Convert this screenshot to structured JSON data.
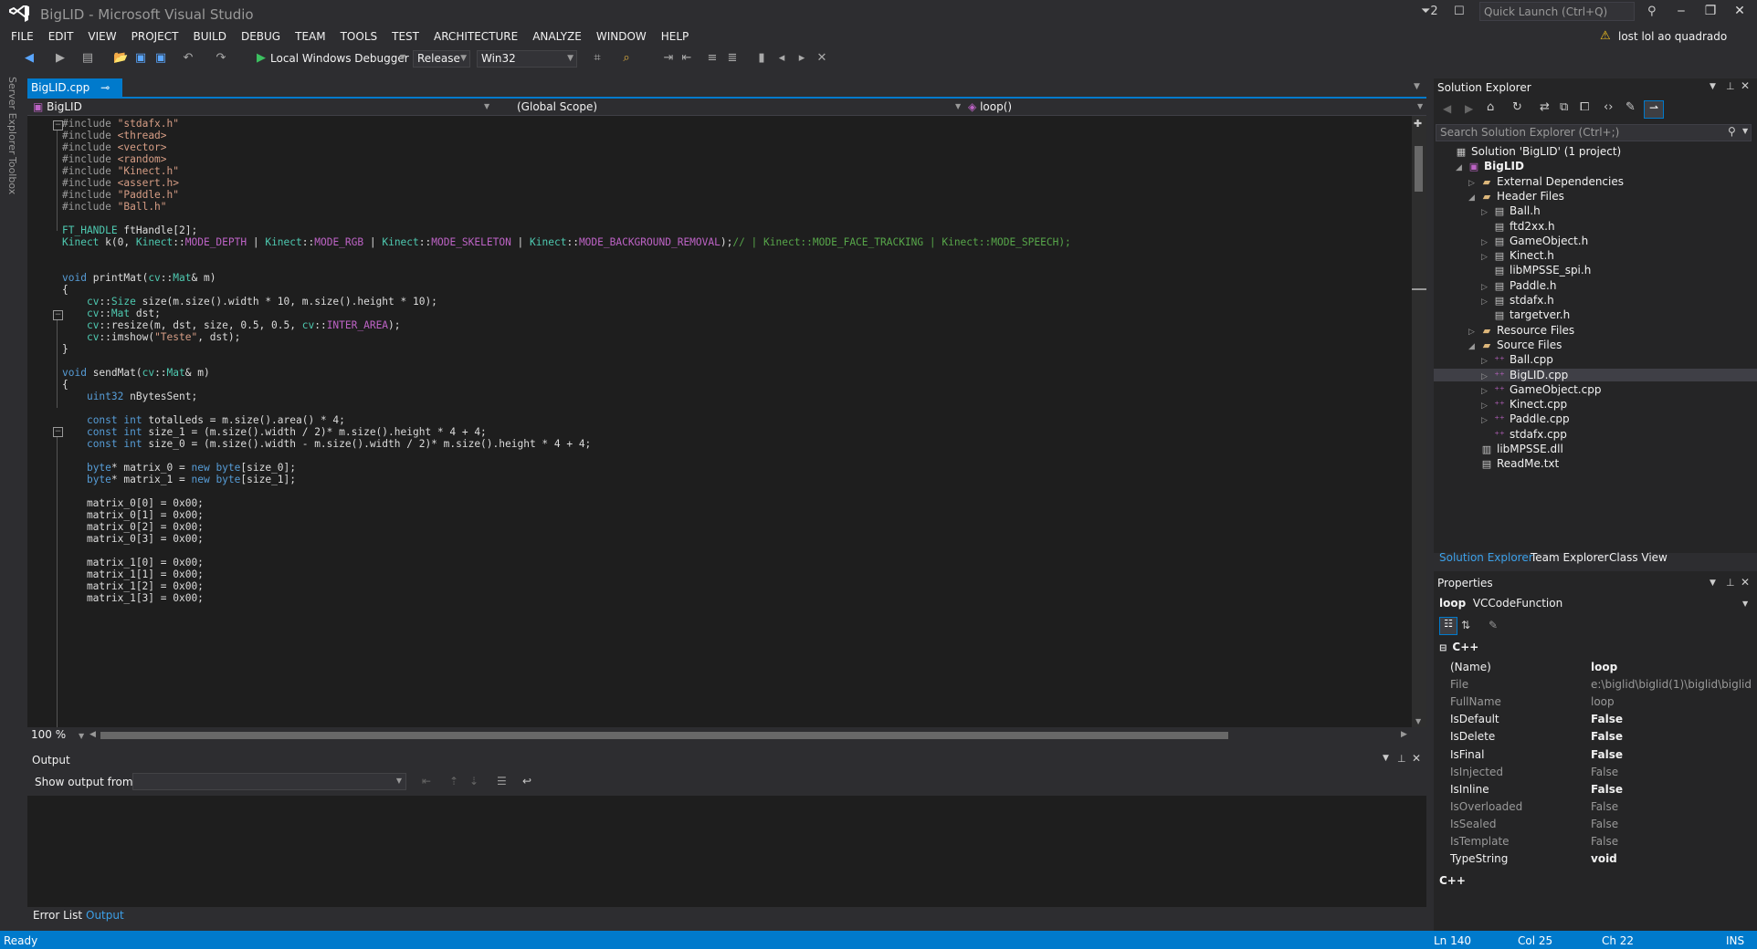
{
  "window": {
    "title": "BigLID - Microsoft Visual Studio",
    "notifications": "2",
    "quick_launch_placeholder": "Quick Launch (Ctrl+Q)",
    "user": "lost lol ao quadrado"
  },
  "menu": [
    "FILE",
    "EDIT",
    "VIEW",
    "PROJECT",
    "BUILD",
    "DEBUG",
    "TEAM",
    "TOOLS",
    "TEST",
    "ARCHITECTURE",
    "ANALYZE",
    "WINDOW",
    "HELP"
  ],
  "toolbar": {
    "debugger": "Local Windows Debugger",
    "config": "Release",
    "platform": "Win32"
  },
  "left_strip": [
    "Server Explorer",
    "Toolbox"
  ],
  "editor": {
    "tab": "BigLID.cpp",
    "nav_project": "BigLID",
    "nav_scope": "(Global Scope)",
    "nav_member": "loop()",
    "zoom": "100 %",
    "lines": [
      "#include \"stdafx.h\"",
      "#include <thread>",
      "#include <vector>",
      "#include <random>",
      "#include \"Kinect.h\"",
      "#include <assert.h>",
      "#include \"Paddle.h\"",
      "#include \"Ball.h\"",
      "",
      "FT_HANDLE ftHandle[2];",
      "Kinect k(0, Kinect::MODE_DEPTH | Kinect::MODE_RGB | Kinect::MODE_SKELETON | Kinect::MODE_BACKGROUND_REMOVAL);// | Kinect::MODE_FACE_TRACKING | Kinect::MODE_SPEECH);",
      "",
      "",
      "void printMat(cv::Mat& m)",
      "{",
      "    cv::Size size(m.size().width * 10, m.size().height * 10);",
      "    cv::Mat dst;",
      "    cv::resize(m, dst, size, 0.5, 0.5, cv::INTER_AREA);",
      "    cv::imshow(\"Teste\", dst);",
      "}",
      "",
      "void sendMat(cv::Mat& m)",
      "{",
      "    uint32 nBytesSent;",
      "",
      "    const int totalLeds = m.size().area() * 4;",
      "    const int size_1 = (m.size().width / 2)* m.size().height * 4 + 4;",
      "    const int size_0 = (m.size().width - m.size().width / 2)* m.size().height * 4 + 4;",
      "",
      "    byte* matrix_0 = new byte[size_0];",
      "    byte* matrix_1 = new byte[size_1];",
      "",
      "    matrix_0[0] = 0x00;",
      "    matrix_0[1] = 0x00;",
      "    matrix_0[2] = 0x00;",
      "    matrix_0[3] = 0x00;",
      "",
      "    matrix_1[0] = 0x00;",
      "    matrix_1[1] = 0x00;",
      "    matrix_1[2] = 0x00;",
      "    matrix_1[3] = 0x00;"
    ]
  },
  "output": {
    "title": "Output",
    "show_from": "Show output from:",
    "tabs": [
      "Error List",
      "Output"
    ]
  },
  "status": {
    "left": "Ready",
    "ln": "Ln 140",
    "col": "Col 25",
    "ch": "Ch 22",
    "mode": "INS"
  },
  "solution_explorer": {
    "title": "Solution Explorer",
    "search_placeholder": "Search Solution Explorer (Ctrl+;)",
    "items": [
      {
        "label": "Solution 'BigLID' (1 project)",
        "level": 0,
        "icon": "solution-icon",
        "twisty": ""
      },
      {
        "label": "BigLID",
        "level": 1,
        "icon": "project-icon",
        "twisty": "open",
        "bold": true
      },
      {
        "label": "External Dependencies",
        "level": 2,
        "icon": "folder-icon",
        "twisty": "closed"
      },
      {
        "label": "Header Files",
        "level": 2,
        "icon": "folder-icon",
        "twisty": "open"
      },
      {
        "label": "Ball.h",
        "level": 3,
        "icon": "header-file-icon",
        "twisty": "closed"
      },
      {
        "label": "ftd2xx.h",
        "level": 3,
        "icon": "header-file-icon",
        "twisty": ""
      },
      {
        "label": "GameObject.h",
        "level": 3,
        "icon": "header-file-icon",
        "twisty": "closed"
      },
      {
        "label": "Kinect.h",
        "level": 3,
        "icon": "header-file-icon",
        "twisty": "closed"
      },
      {
        "label": "libMPSSE_spi.h",
        "level": 3,
        "icon": "header-file-icon",
        "twisty": ""
      },
      {
        "label": "Paddle.h",
        "level": 3,
        "icon": "header-file-icon",
        "twisty": "closed"
      },
      {
        "label": "stdafx.h",
        "level": 3,
        "icon": "header-file-icon",
        "twisty": "closed"
      },
      {
        "label": "targetver.h",
        "level": 3,
        "icon": "header-file-icon",
        "twisty": ""
      },
      {
        "label": "Resource Files",
        "level": 2,
        "icon": "folder-icon",
        "twisty": "closed"
      },
      {
        "label": "Source Files",
        "level": 2,
        "icon": "folder-icon",
        "twisty": "open"
      },
      {
        "label": "Ball.cpp",
        "level": 3,
        "icon": "cpp-file-icon",
        "twisty": "closed"
      },
      {
        "label": "BigLID.cpp",
        "level": 3,
        "icon": "cpp-file-icon",
        "twisty": "closed",
        "selected": true
      },
      {
        "label": "GameObject.cpp",
        "level": 3,
        "icon": "cpp-file-icon",
        "twisty": "closed"
      },
      {
        "label": "Kinect.cpp",
        "level": 3,
        "icon": "cpp-file-icon",
        "twisty": "closed"
      },
      {
        "label": "Paddle.cpp",
        "level": 3,
        "icon": "cpp-file-icon",
        "twisty": "closed"
      },
      {
        "label": "stdafx.cpp",
        "level": 3,
        "icon": "cpp-file-icon",
        "twisty": ""
      },
      {
        "label": "libMPSSE.dll",
        "level": 2,
        "icon": "dll-file-icon",
        "twisty": ""
      },
      {
        "label": "ReadMe.txt",
        "level": 2,
        "icon": "text-file-icon",
        "twisty": ""
      }
    ],
    "tabs": [
      "Solution Explorer",
      "Team Explorer",
      "Class View"
    ]
  },
  "properties": {
    "title": "Properties",
    "object_name": "loop",
    "object_type": "VCCodeFunction",
    "category": "C++",
    "rows": [
      {
        "name": "(Name)",
        "value": "loop",
        "dim": false,
        "bold": true
      },
      {
        "name": "File",
        "value": "e:\\biglid\\biglid(1)\\biglid\\biglid\\",
        "dim": true
      },
      {
        "name": "FullName",
        "value": "loop",
        "dim": true
      },
      {
        "name": "IsDefault",
        "value": "False",
        "dim": false,
        "bold": true
      },
      {
        "name": "IsDelete",
        "value": "False",
        "dim": false,
        "bold": true
      },
      {
        "name": "IsFinal",
        "value": "False",
        "dim": false,
        "bold": true
      },
      {
        "name": "IsInjected",
        "value": "False",
        "dim": true
      },
      {
        "name": "IsInline",
        "value": "False",
        "dim": false,
        "bold": true
      },
      {
        "name": "IsOverloaded",
        "value": "False",
        "dim": true
      },
      {
        "name": "IsSealed",
        "value": "False",
        "dim": true
      },
      {
        "name": "IsTemplate",
        "value": "False",
        "dim": true
      },
      {
        "name": "TypeString",
        "value": "void",
        "dim": false,
        "bold": true
      }
    ],
    "description": "C++"
  },
  "colors": {
    "accent": "#007acc",
    "editor_bg": "#1e1e1e",
    "chrome_bg": "#2d2d30"
  }
}
